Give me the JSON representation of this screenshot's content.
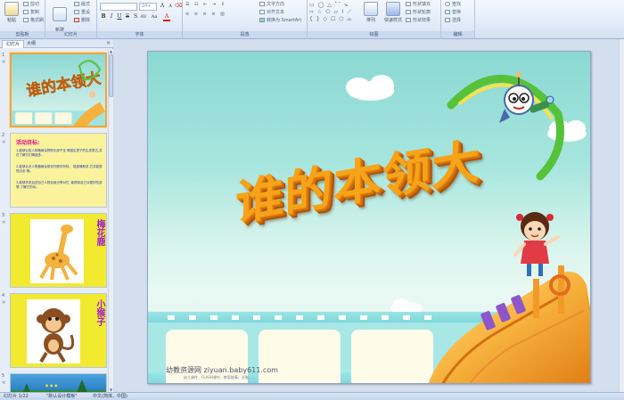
{
  "ribbon": {
    "clipboard": {
      "paste_label": "粘贴",
      "cut_label": "剪切",
      "copy_label": "复制",
      "format_painter_label": "格式刷",
      "group_label": "剪贴板"
    },
    "slides": {
      "new_slide_label": "新建\n幻灯片",
      "layout_label": "版式",
      "reset_label": "重设",
      "delete_label": "删除",
      "group_label": "幻灯片"
    },
    "font": {
      "size_value": "24+",
      "group_label": "字体"
    },
    "paragraph": {
      "text_direction_label": "文字方向",
      "align_text_label": "对齐文本",
      "smartart_label": "转换为 SmartArt",
      "group_label": "段落"
    },
    "drawing": {
      "arrange_label": "排列",
      "quick_styles_label": "快速样式",
      "shape_fill_label": "形状填充",
      "shape_outline_label": "形状轮廓",
      "shape_effects_label": "形状效果",
      "group_label": "绘图"
    },
    "editing": {
      "find_label": "查找",
      "replace_label": "替换",
      "select_label": "选择",
      "group_label": "编辑"
    }
  },
  "panel": {
    "tab_slides": "幻灯片",
    "tab_outline": "大纲",
    "close_glyph": "×"
  },
  "thumbnails": [
    {
      "number": "1",
      "star": "✲"
    },
    {
      "number": "2",
      "star": "✲",
      "heading": "活动目标:",
      "lines": [
        "1.能够认知人物格局及物别头部子全 情感区里子的生成表达,并在了解它们情绪多。",
        "2.能够认识人物格局及带状外眼中阿特。 能激情和多,它并能表现出全 情。",
        "3.能够学说自述自己人物自身分享对它, 能得到自己对更好的游想,了解它的动。"
      ]
    },
    {
      "number": "3",
      "star": "✲",
      "label": "梅花鹿"
    },
    {
      "number": "4",
      "star": "✲",
      "label": "小猴子"
    },
    {
      "number": "5",
      "star": "✲"
    }
  ],
  "slide": {
    "title": "谁的本领大",
    "watermark": "幼教资源网 ziyuan.baby611.com",
    "watermark_sub": "幼儿课件、FLASH课件、教案故事、试卷......"
  },
  "status": {
    "slide_counter": "幻灯片 1/22",
    "theme_name": "\"默认设计模板\"",
    "language": "中文(简体，中国)"
  }
}
